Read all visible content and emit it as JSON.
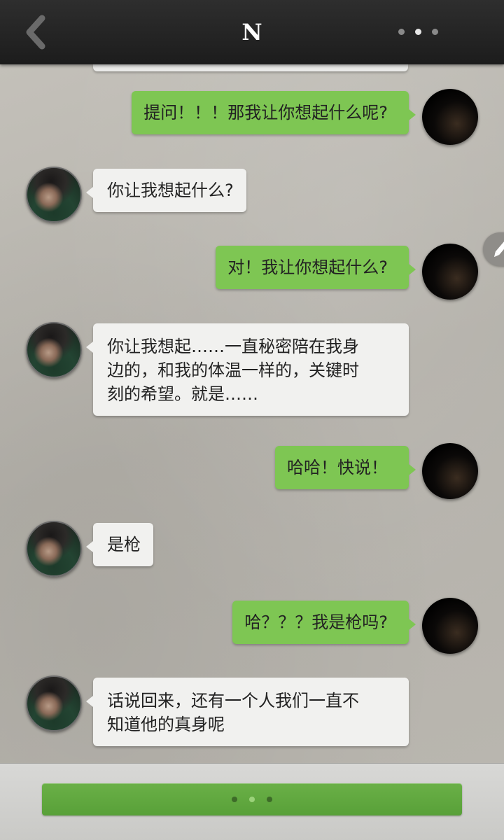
{
  "header": {
    "back_icon": "chevron-left-icon",
    "title": "N",
    "more_icon": "more-dots-icon"
  },
  "messages": [
    {
      "side": "out",
      "text": "提问！！！那我让你想起什么呢?"
    },
    {
      "side": "in",
      "lines": [
        "你让我想起什么?"
      ]
    },
    {
      "side": "out",
      "text": "对！我让你想起什么?"
    },
    {
      "side": "in",
      "lines": [
        "你让我想起……一直秘密陪在我身",
        "边的，和我的体温一样的，关键时",
        "刻的希望。就是……"
      ]
    },
    {
      "side": "out",
      "text": "哈哈！快说！"
    },
    {
      "side": "in",
      "lines": [
        "是枪"
      ]
    },
    {
      "side": "out",
      "text": "哈？？？我是枪吗?"
    },
    {
      "side": "in",
      "lines": [
        "话说回来，还有一个人我们一直不",
        "知道他的真身呢"
      ]
    }
  ],
  "edit_icon": "pencil-icon",
  "footer": {
    "continue_icon": "loading-dots-icon"
  },
  "colors": {
    "header_bg": "#232323",
    "outgoing_bubble": "#7ec653",
    "incoming_bubble": "#f1f1ef",
    "footer_button": "#5fa83e"
  }
}
